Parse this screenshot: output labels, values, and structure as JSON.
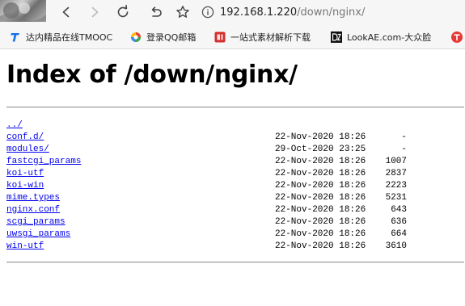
{
  "browser": {
    "url_host": "192.168.1.220",
    "url_path": "/down/nginx/"
  },
  "bookmarks": [
    {
      "label": "达内精品在线TMOOC",
      "icon": "tmooc-icon",
      "color": "#1a73e8"
    },
    {
      "label": "登录QQ邮箱",
      "icon": "qq-mail-icon",
      "color": "#e8a317"
    },
    {
      "label": "一站式素材解析下载",
      "icon": "material-download-icon",
      "color": "#d32f2f"
    },
    {
      "label": "LookAE.com-大众脸",
      "icon": "lookae-icon",
      "color": "#111111"
    }
  ],
  "page": {
    "title": "Index of /down/nginx/"
  },
  "listing": [
    {
      "name": "../",
      "date": "",
      "size": ""
    },
    {
      "name": "conf.d/",
      "date": "22-Nov-2020 18:26",
      "size": "-"
    },
    {
      "name": "modules/",
      "date": "29-Oct-2020 23:25",
      "size": "-"
    },
    {
      "name": "fastcgi_params",
      "date": "22-Nov-2020 18:26",
      "size": "1007"
    },
    {
      "name": "koi-utf",
      "date": "22-Nov-2020 18:26",
      "size": "2837"
    },
    {
      "name": "koi-win",
      "date": "22-Nov-2020 18:26",
      "size": "2223"
    },
    {
      "name": "mime.types",
      "date": "22-Nov-2020 18:26",
      "size": "5231"
    },
    {
      "name": "nginx.conf",
      "date": "22-Nov-2020 18:26",
      "size": "643"
    },
    {
      "name": "scgi_params",
      "date": "22-Nov-2020 18:26",
      "size": "636"
    },
    {
      "name": "uwsgi_params",
      "date": "22-Nov-2020 18:26",
      "size": "664"
    },
    {
      "name": "win-utf",
      "date": "22-Nov-2020 18:26",
      "size": "3610"
    }
  ],
  "colors": {
    "link": "#0000ee",
    "chrome_bg": "#f6f6f6",
    "extension_red": "#e53935"
  }
}
